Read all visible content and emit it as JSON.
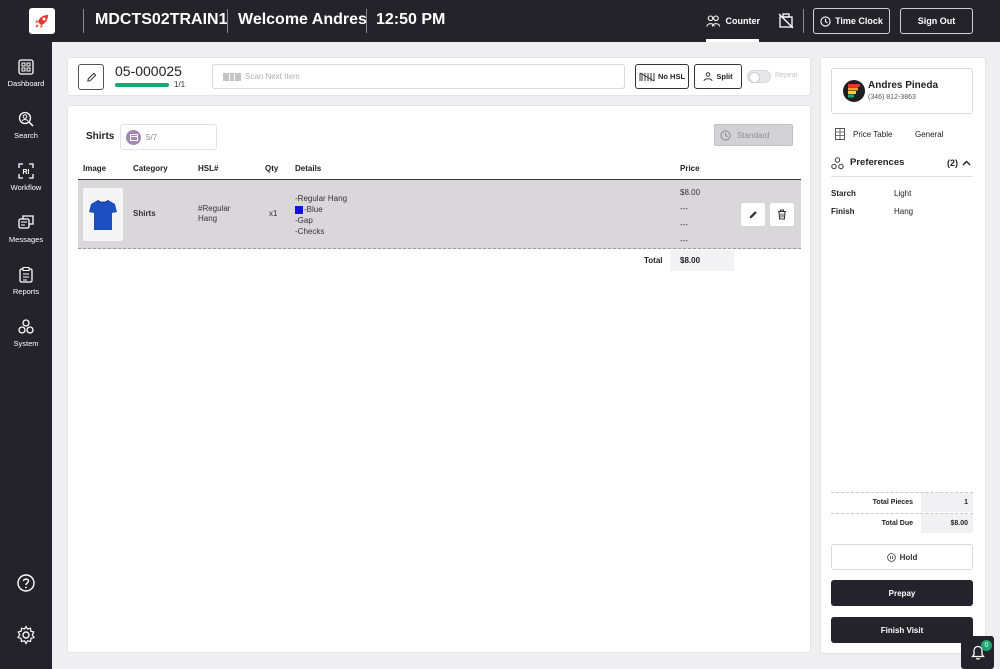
{
  "header": {
    "store": "MDCTS02TRAIN1",
    "welcome": "Welcome Andres",
    "time": "12:50 PM",
    "counter_label": "Counter",
    "time_clock_label": "Time Clock",
    "sign_out_label": "Sign Out"
  },
  "sidebar": {
    "items": [
      {
        "label": "Dashboard",
        "icon": "dashboard-icon"
      },
      {
        "label": "Search",
        "icon": "search-icon"
      },
      {
        "label": "Workflow",
        "icon": "workflow-icon"
      },
      {
        "label": "Messages",
        "icon": "messages-icon"
      },
      {
        "label": "Reports",
        "icon": "reports-icon"
      },
      {
        "label": "System",
        "icon": "system-icon"
      }
    ]
  },
  "order": {
    "number": "05-000025",
    "progress_text": "1/1",
    "progress_fraction": 1.0,
    "scan_placeholder": "Scan Next Item",
    "no_hsl_label": "No HSL",
    "split_label": "Split",
    "repeat_label": "Repeat"
  },
  "category": {
    "title": "Shirts",
    "count": "5/7",
    "service_label": "Standard"
  },
  "table": {
    "headers": [
      "Image",
      "Category",
      "HSL#",
      "Qty",
      "Details",
      "Price"
    ],
    "rows": [
      {
        "category": "Shirts",
        "hsl": "#Regular Hang",
        "qty": "x1",
        "details": [
          "-Regular Hang",
          "-Blue",
          "-Gap",
          "-Checks"
        ],
        "color_swatch": "#1414d4",
        "prices": [
          "$8.00",
          "---",
          "---",
          "---"
        ]
      }
    ],
    "total_label": "Total",
    "total_value": "$8.00"
  },
  "customer": {
    "name": "Andres Pineda",
    "phone": "(346) 812-3863",
    "price_table_label": "Price Table",
    "price_table_value": "General",
    "preferences_label": "Preferences",
    "preferences_count": "(2)",
    "preferences": [
      {
        "name": "Starch",
        "value": "Light"
      },
      {
        "name": "Finish",
        "value": "Hang"
      }
    ]
  },
  "summary": {
    "total_pieces_label": "Total Pieces",
    "total_pieces_value": "1",
    "total_due_label": "Total Due",
    "total_due_value": "$8.00",
    "hold_label": "Hold",
    "prepay_label": "Prepay",
    "finish_label": "Finish Visit"
  },
  "notifications": {
    "count": "0"
  },
  "colors": {
    "accent_green": "#1ca673",
    "dark": "#24232b",
    "category_badge": "#a286b4"
  }
}
